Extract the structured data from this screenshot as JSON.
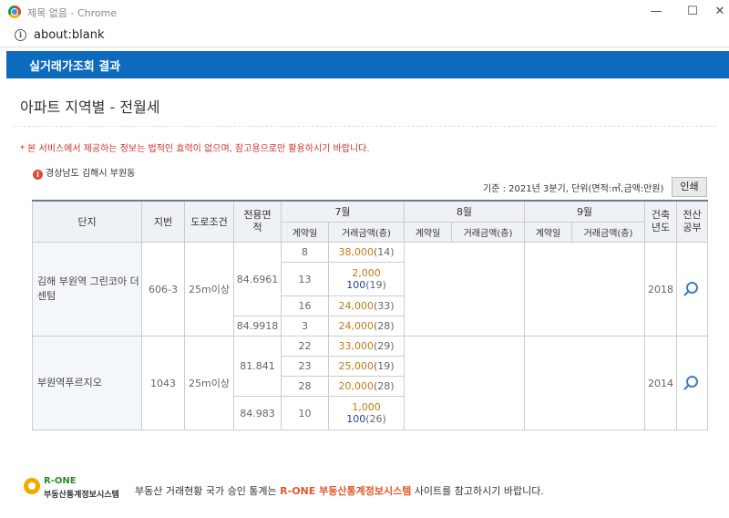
{
  "window": {
    "title": "제목 없음 - Chrome",
    "minimize": "—",
    "maximize": "☐",
    "close": "✕",
    "url": "about:blank"
  },
  "header": {
    "band_title": "실거래가조회 결과"
  },
  "page": {
    "title": "아파트 지역별 - 전월세",
    "notice": "* 본 서비스에서 제공하는 정보는 법적인 효력이 없으며, 참고용으로만 활용하시기 바랍니다.",
    "region": "경상남도 김해시 부원동",
    "criteria": "기준 : 2021년 3분기, 단위(면적:㎡,금액:만원)",
    "print_label": "인쇄"
  },
  "table": {
    "headers": {
      "complex": "단지",
      "lot": "지번",
      "road": "도로조건",
      "area": "전용면적",
      "build_year": "건축년도",
      "registry": "전산공부",
      "months": [
        "7월",
        "8월",
        "9월"
      ],
      "contract_day": "계약일",
      "deal_amount": "거래금액(층)"
    },
    "complex1": {
      "name": "김해 부원역 그린코아 더센텀",
      "lot": "606-3",
      "road": "25m이상",
      "area_a": "84.6961",
      "area_b": "84.9918",
      "year": "2018",
      "r1": {
        "day": "8",
        "amount": "38,000",
        "floor": "(14)"
      },
      "r2": {
        "day": "13",
        "deposit": "2,000",
        "rent": "100",
        "floor": "(19)"
      },
      "r3": {
        "day": "16",
        "amount": "24,000",
        "floor": "(33)"
      },
      "r4": {
        "day": "3",
        "amount": "24,000",
        "floor": "(28)"
      }
    },
    "complex2": {
      "name": "부원역푸르지오",
      "lot": "1043",
      "road": "25m이상",
      "area_a": "81.841",
      "area_b": "84.983",
      "year": "2014",
      "r1": {
        "day": "22",
        "amount": "33,000",
        "floor": "(29)"
      },
      "r2": {
        "day": "23",
        "amount": "25,000",
        "floor": "(19)"
      },
      "r3": {
        "day": "28",
        "amount": "20,000",
        "floor": "(28)"
      },
      "r4": {
        "day": "10",
        "deposit": "1,000",
        "rent": "100",
        "floor": "(26)"
      }
    }
  },
  "footer": {
    "logo_eng": "R-ONE",
    "logo_kor": "부동산통계정보시스템",
    "text_prefix": "부동산 거래현황 국가 승인 통계는 ",
    "text_highlight": "R-ONE 부동산통계정보시스템",
    "text_suffix": " 사이트를 참고하시기 바랍니다."
  },
  "colors": {
    "band": "#0c6bbd",
    "notice": "#d0322c",
    "amount": "#c37b13",
    "rent": "#1f3f8f",
    "highlight": "#e0592a"
  },
  "icons": [
    "chrome-logo-icon",
    "info-icon",
    "location-icon",
    "search-icon",
    "rone-logo-icon"
  ]
}
